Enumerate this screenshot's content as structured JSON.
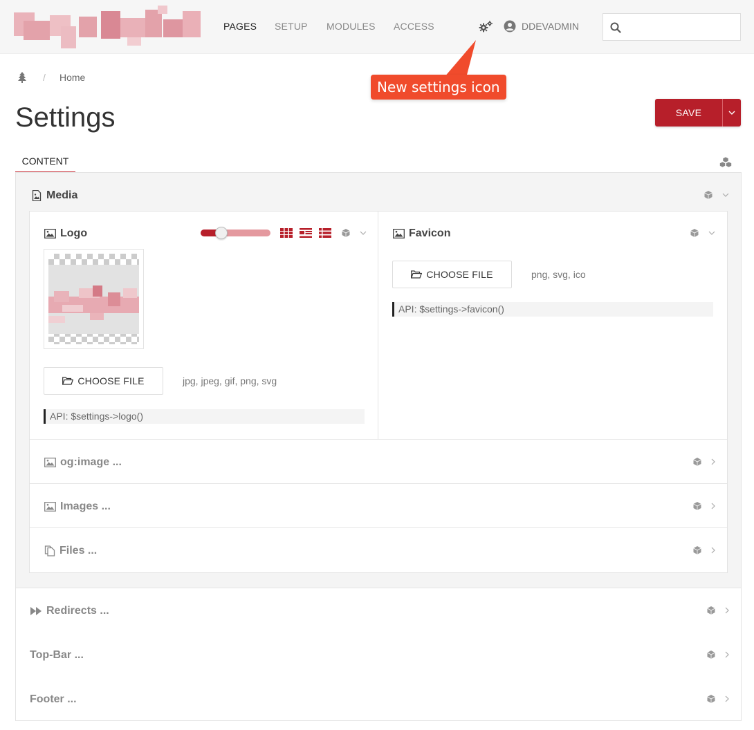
{
  "nav": {
    "items": [
      {
        "label": "PAGES",
        "active": true
      },
      {
        "label": "SETUP",
        "active": false
      },
      {
        "label": "MODULES",
        "active": false
      },
      {
        "label": "ACCESS",
        "active": false
      }
    ],
    "user_label": "DDEVADMIN",
    "search_value": "",
    "icons": {
      "settings": "gears-icon",
      "user": "user-circle-icon",
      "search": "search-icon"
    }
  },
  "callout": {
    "text": "New settings icon"
  },
  "breadcrumb": {
    "root_icon": "tree-icon",
    "separator": "/",
    "home": "Home"
  },
  "page": {
    "title": "Settings",
    "save_label": "SAVE"
  },
  "tabs": [
    {
      "label": "CONTENT",
      "active": true
    }
  ],
  "media": {
    "title": "Media",
    "logo": {
      "title": "Logo",
      "choose_label": "CHOOSE FILE",
      "extensions": "jpg, jpeg, gif, png, svg",
      "api": "API: $settings->logo()",
      "thumb_size": 0.3
    },
    "favicon": {
      "title": "Favicon",
      "choose_label": "CHOOSE FILE",
      "extensions": "png, svg, ico",
      "api": "API: $settings->favicon()"
    },
    "collapsed": [
      {
        "title": "og:image ...",
        "icon": "image-icon"
      },
      {
        "title": "Images ...",
        "icon": "image-icon"
      },
      {
        "title": "Files ...",
        "icon": "files-icon"
      }
    ]
  },
  "sections": [
    {
      "title": "Redirects ...",
      "icon": "fast-forward-icon"
    },
    {
      "title": "Top-Bar ...",
      "icon": ""
    },
    {
      "title": "Footer ...",
      "icon": ""
    }
  ],
  "colors": {
    "accent": "#b71f2a",
    "callout": "#f04b2c"
  }
}
